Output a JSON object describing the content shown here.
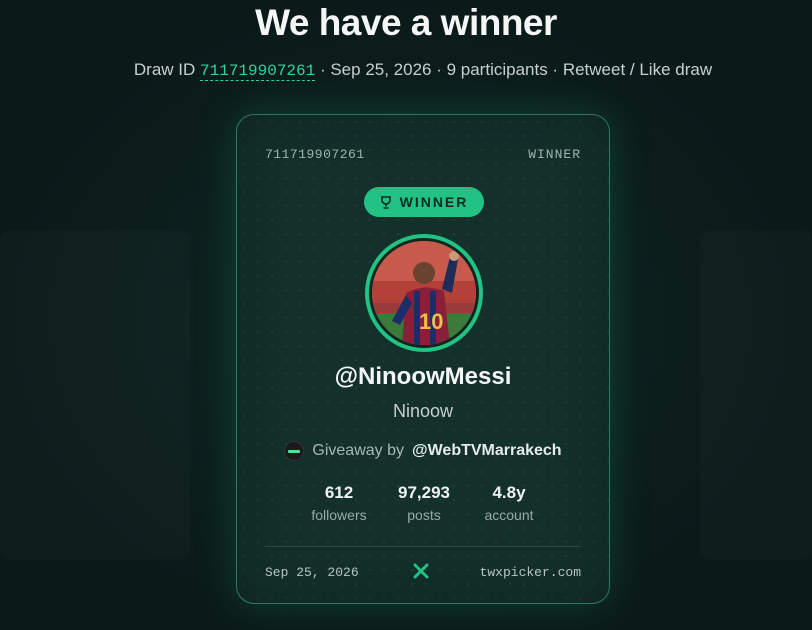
{
  "header": {
    "title": "We have a winner",
    "draw_id_prefix": "Draw ID ",
    "draw_id": "711719907261",
    "meta_rest": " · Sep 25, 2026 · 9 participants · Retweet / Like draw"
  },
  "card": {
    "id": "711719907261",
    "tag": "WINNER",
    "badge_label": "WINNER",
    "handle": "@NinoowMessi",
    "display_name": "Ninoow",
    "giveaway_prefix": "Giveaway by",
    "giveaway_host": "@WebTVMarrakech",
    "stats": [
      {
        "value": "612",
        "label": "followers"
      },
      {
        "value": "97,293",
        "label": "posts"
      },
      {
        "value": "4.8y",
        "label": "account"
      }
    ],
    "footer_date": "Sep 25, 2026",
    "footer_site": "twxpicker.com"
  },
  "icons": {
    "badge": "trophy-icon",
    "footer": "x-logo-icon",
    "host": "host-avatar"
  },
  "colors": {
    "accent": "#22c184",
    "background": "#0b1a19",
    "card": "#13302b"
  }
}
